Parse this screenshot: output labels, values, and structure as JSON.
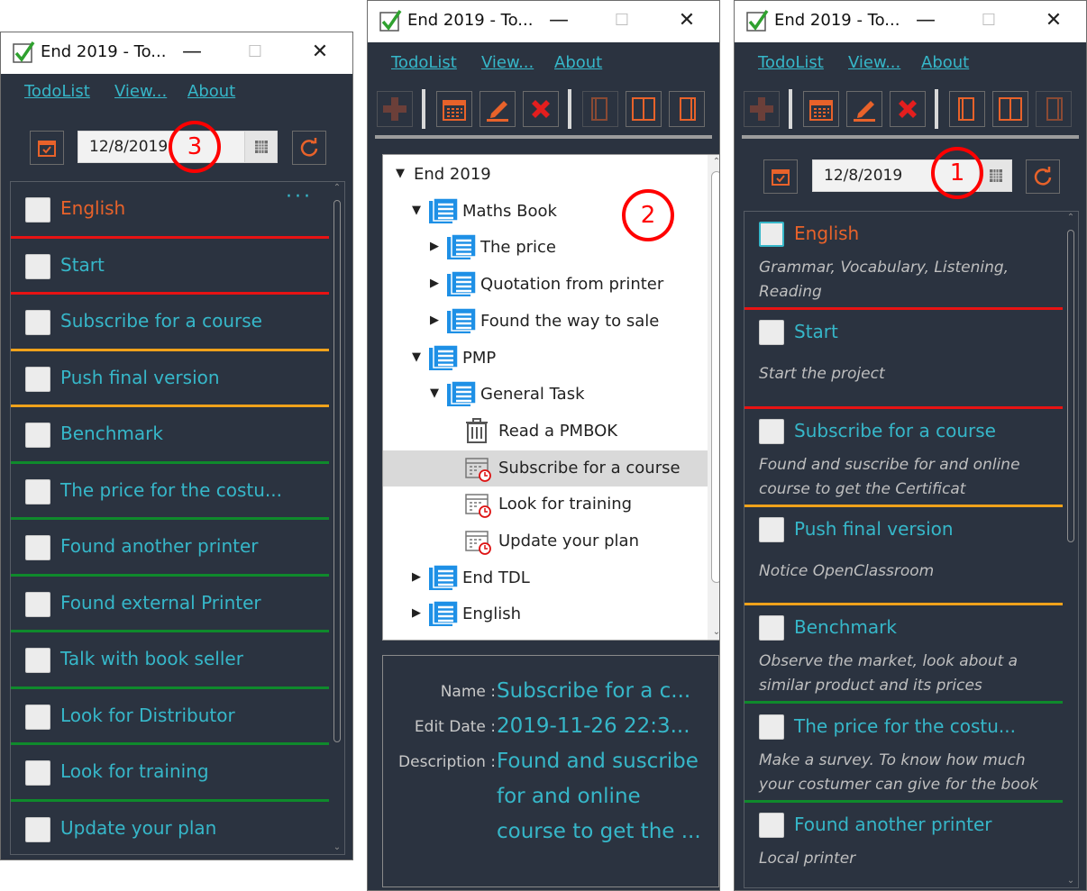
{
  "app": {
    "title": "End 2019 - To...",
    "menu": [
      "TodoList",
      "View...",
      "About"
    ]
  },
  "left_window": {
    "date": "12/8/2019",
    "marker": "3",
    "items": [
      {
        "title": "English",
        "color": "orange"
      },
      {
        "title": "Start",
        "color": "cyan"
      },
      {
        "title": "Subscribe for a course",
        "color": "cyan"
      },
      {
        "title": "Push final version",
        "color": "cyan"
      },
      {
        "title": "Benchmark",
        "color": "cyan"
      },
      {
        "title": "The price for the costu...",
        "color": "cyan"
      },
      {
        "title": "Found another printer",
        "color": "cyan"
      },
      {
        "title": "Found external Printer",
        "color": "cyan"
      },
      {
        "title": "Talk with book seller",
        "color": "cyan"
      },
      {
        "title": "Look for Distributor",
        "color": "cyan"
      },
      {
        "title": "Look for training",
        "color": "cyan"
      },
      {
        "title": "Update your plan",
        "color": "cyan"
      }
    ],
    "separators": [
      "#e81313",
      "#e81313",
      "#f0a21b",
      "#f0a21b",
      "#0f8a2c",
      "#0f8a2c",
      "#0f8a2c",
      "#0f8a2c",
      "#0f8a2c",
      "#0f8a2c",
      "#0f8a2c",
      "#8dcc5a"
    ],
    "more_icon": "ellipsis-icon"
  },
  "middle_window": {
    "marker": "2",
    "tree": [
      {
        "label": "End 2019",
        "caret": "expanded",
        "icon": "none"
      },
      {
        "label": "Maths Book",
        "caret": "expanded",
        "icon": "list-icon"
      },
      {
        "label": "The price",
        "caret": "collapsed",
        "icon": "list-icon"
      },
      {
        "label": "Quotation from printer",
        "caret": "collapsed",
        "icon": "list-icon"
      },
      {
        "label": "Found the way to sale",
        "caret": "collapsed",
        "icon": "list-icon"
      },
      {
        "label": "PMP",
        "caret": "expanded",
        "icon": "list-icon"
      },
      {
        "label": "General Task",
        "caret": "expanded",
        "icon": "list-icon"
      },
      {
        "label": "Read a PMBOK",
        "caret": "none",
        "icon": "trash-icon"
      },
      {
        "label": "Subscribe for a course",
        "caret": "none",
        "icon": "calendar-clock-icon",
        "selected": true
      },
      {
        "label": "Look for training",
        "caret": "none",
        "icon": "calendar-clock-icon"
      },
      {
        "label": "Update your plan",
        "caret": "none",
        "icon": "calendar-clock-icon"
      },
      {
        "label": "End TDL",
        "caret": "collapsed",
        "icon": "list-icon"
      },
      {
        "label": "English",
        "caret": "collapsed",
        "icon": "list-icon"
      }
    ],
    "details": {
      "name_label": "Name :",
      "name_value": "Subscribe for a c...",
      "edit_label": "Edit Date :",
      "edit_value": "2019-11-26 22:3...",
      "desc_label": "Description :",
      "desc_value": "Found and suscribe for and online course to get the ..."
    }
  },
  "right_window": {
    "date": "12/8/2019",
    "marker": "1",
    "items": [
      {
        "title": "English",
        "color": "orange",
        "desc": "Grammar, Vocabulary, Listening, Reading"
      },
      {
        "title": "Start",
        "color": "cyan",
        "desc": "Start the project"
      },
      {
        "title": "Subscribe for a course",
        "color": "cyan",
        "desc": "Found and suscribe for and online course to get the Certificat"
      },
      {
        "title": "Push final version",
        "color": "cyan",
        "desc": "Notice OpenClassroom"
      },
      {
        "title": "Benchmark",
        "color": "cyan",
        "desc": "Observe the market, look about a similar product and its prices"
      },
      {
        "title": "The price for the costu...",
        "color": "cyan",
        "desc": "Make a survey. To know how much your costumer can give for the book"
      },
      {
        "title": "Found another printer",
        "color": "cyan",
        "desc": "Local printer"
      }
    ],
    "separators": [
      "#e81313",
      "#e81313",
      "#f0a21b",
      "#f0a21b",
      "#0f8a2c",
      "#0f8a2c",
      "#0f8a2c"
    ]
  },
  "colors": {
    "background": "#2b3340",
    "accent_cyan": "#36b7c9",
    "accent_orange": "#e8622a",
    "marker_red": "#ff0000"
  }
}
